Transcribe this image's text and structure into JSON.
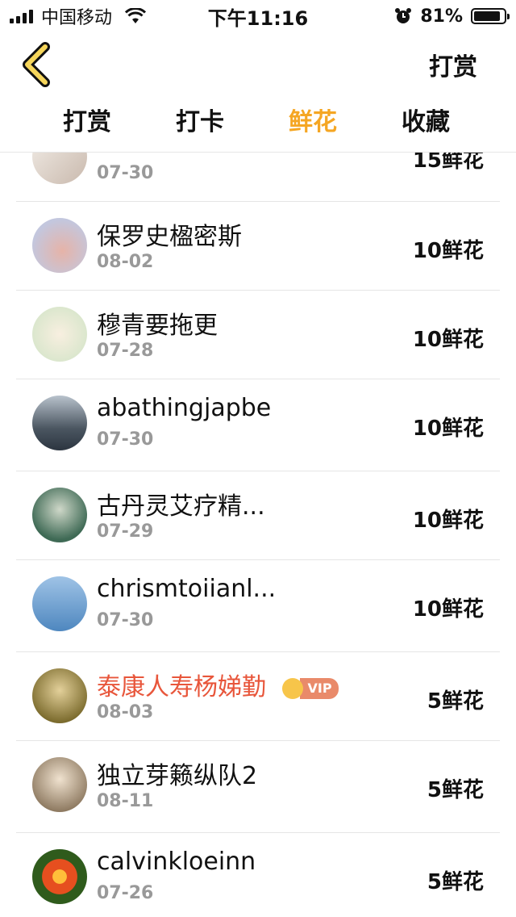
{
  "status_bar": {
    "carrier": "中国移动",
    "time": "下午11:16",
    "battery_text": "81%",
    "battery_level": 0.81
  },
  "nav": {
    "back_icon": "chevron-left-icon",
    "action_label": "打赏"
  },
  "tabs": [
    {
      "label": "打赏",
      "active": false
    },
    {
      "label": "打卡",
      "active": false
    },
    {
      "label": "鲜花",
      "active": true
    },
    {
      "label": "收藏",
      "active": false
    }
  ],
  "colors": {
    "accent": "#f5a623",
    "vip_name": "#e8563b",
    "date": "#999999"
  },
  "rows": [
    {
      "name": "",
      "date": "07-30",
      "amount": "15鲜花",
      "vip": false
    },
    {
      "name": "保罗史楹密斯",
      "date": "08-02",
      "amount": "10鲜花",
      "vip": false
    },
    {
      "name": "穆青要拖更",
      "date": "07-28",
      "amount": "10鲜花",
      "vip": false
    },
    {
      "name": "abathingjapbe",
      "date": "07-30",
      "amount": "10鲜花",
      "vip": false
    },
    {
      "name": "古丹灵艾疗精...",
      "date": "07-29",
      "amount": "10鲜花",
      "vip": false
    },
    {
      "name": "chrismtoiianl...",
      "date": "07-30",
      "amount": "10鲜花",
      "vip": false
    },
    {
      "name": "泰康人寿杨娣勤",
      "date": "08-03",
      "amount": "5鲜花",
      "vip": true,
      "vip_label": "VIP"
    },
    {
      "name": "独立芽籁纵队2",
      "date": "08-11",
      "amount": "5鲜花",
      "vip": false
    },
    {
      "name": "calvinkloeinn",
      "date": "07-26",
      "amount": "5鲜花",
      "vip": false
    }
  ]
}
